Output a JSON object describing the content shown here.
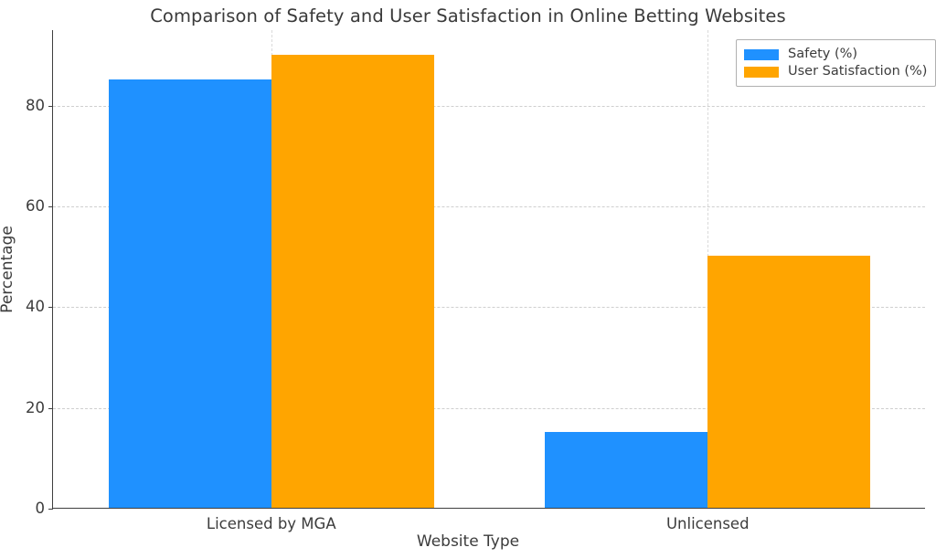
{
  "chart_data": {
    "type": "bar",
    "title": "Comparison of Safety and User Satisfaction in Online Betting Websites",
    "xlabel": "Website Type",
    "ylabel": "Percentage",
    "categories": [
      "Licensed by MGA",
      "Unlicensed"
    ],
    "series": [
      {
        "name": "Safety (%)",
        "color": "#1f91ff",
        "values": [
          85,
          15
        ]
      },
      {
        "name": "User Satisfaction (%)",
        "color": "#ffa500",
        "values": [
          90,
          50
        ]
      }
    ],
    "ylim": [
      0,
      95
    ],
    "yticks": [
      0,
      20,
      40,
      60,
      80
    ],
    "ytick_labels": [
      "0",
      "20",
      "40",
      "60",
      "80"
    ],
    "grid": true,
    "grid_axis": "both",
    "legend_position": "upper right"
  },
  "legend": {
    "entries": [
      {
        "label": "Safety (%)"
      },
      {
        "label": "User Satisfaction (%)"
      }
    ]
  }
}
